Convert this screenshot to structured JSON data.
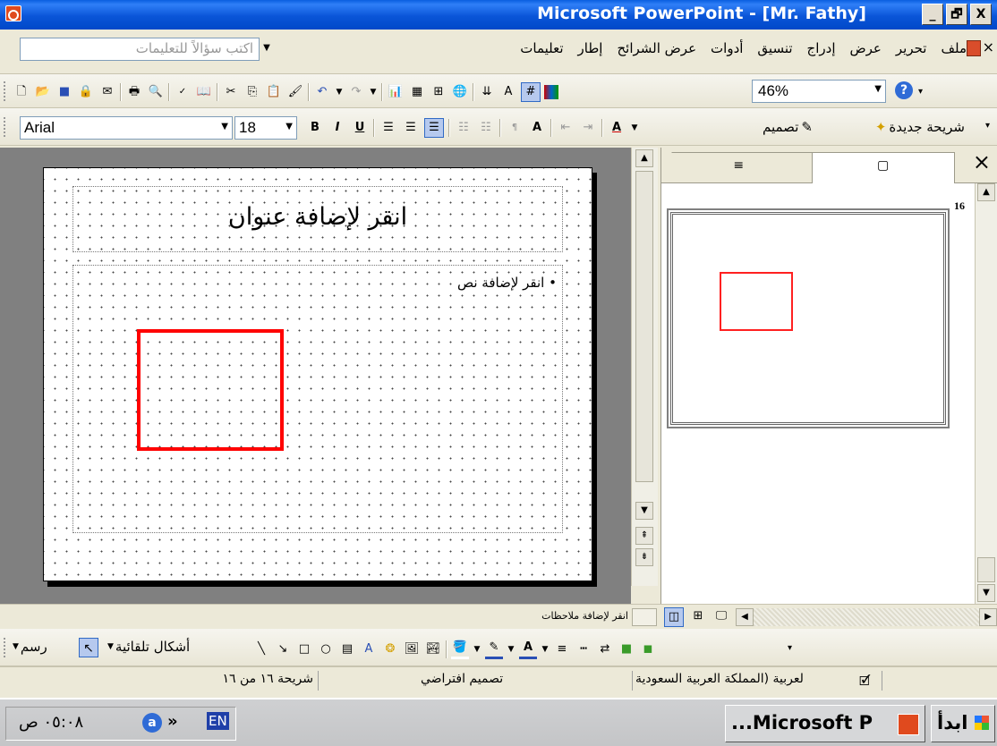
{
  "window": {
    "title": "Microsoft PowerPoint - [Mr. Fathy]",
    "controls": [
      "_",
      "🗗",
      "X"
    ]
  },
  "menubar": {
    "items": [
      "ملف",
      "تحرير",
      "عرض",
      "إدراج",
      "تنسيق",
      "أدوات",
      "عرض الشرائح",
      "إطار",
      "تعليمات"
    ],
    "help_placeholder": "اكتب سؤالاً للتعليمات",
    "close_symbol": "×"
  },
  "standard_toolbar": {
    "zoom": "46%"
  },
  "formatting_toolbar": {
    "font_name": "Arial",
    "font_size": "18",
    "design_label": "تصميم",
    "new_slide_label": "شريحة جديدة"
  },
  "slide": {
    "title_placeholder": "انقر لإضافة عنوان",
    "body_placeholder": "انقر لإضافة نص",
    "bullet": "•",
    "rect_color": "#ff0000"
  },
  "notes": {
    "placeholder": "انقر لإضافة ملاحظات"
  },
  "pane": {
    "slide_number": "16",
    "tab_outline_icon": "≡",
    "tab_slides_icon": "▢",
    "close_symbol": "×"
  },
  "drawing_toolbar": {
    "draw_label": "رسم",
    "autoshapes_label": "أشكال تلقائية"
  },
  "statusbar": {
    "slide_info": "شريحة ١٦ من ١٦",
    "design": "تصميم افتراضي",
    "language": "لعربية (المملكة العربية السعودية"
  },
  "taskbar": {
    "start_label": "ابدأ",
    "task_label": "...Microsoft P",
    "clock": "٠٥:٠٨ ص",
    "lang": "EN",
    "chevron": "»"
  },
  "colors": {
    "title_bar": "#0a55d8",
    "accent_red": "#ff0000"
  }
}
